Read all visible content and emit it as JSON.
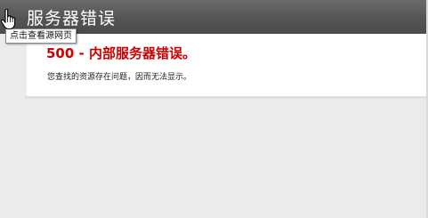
{
  "header": {
    "title": "服务器错误"
  },
  "tooltip": {
    "text": "点击查看源网页"
  },
  "error": {
    "code": "500",
    "separator": "-",
    "message": "内部服务器错误。",
    "description": "您查找的资源存在问题，因而无法显示。"
  },
  "colors": {
    "header_bg": "#555555",
    "error_red": "#cc0000",
    "page_bg": "#ebebeb",
    "panel_bg": "#ffffff"
  },
  "icons": {
    "cursor": "hand-pointer-icon"
  }
}
